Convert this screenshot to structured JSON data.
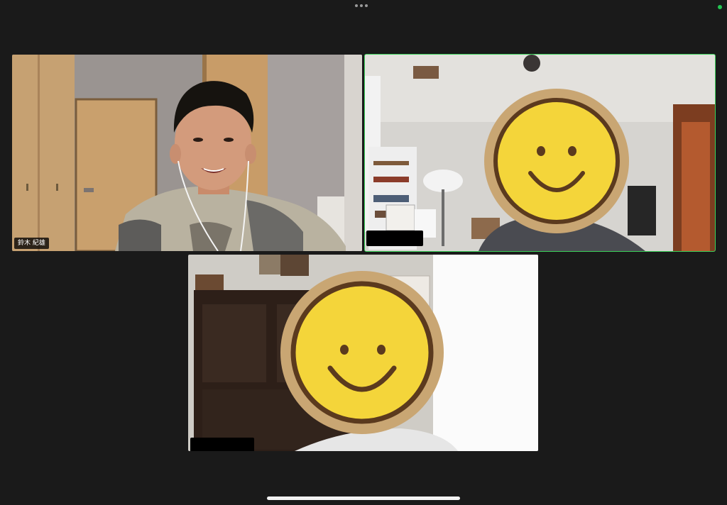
{
  "app": {
    "participants": [
      {
        "name": "鈴木 紀雄",
        "speaking": false,
        "face_obscured": false
      },
      {
        "name": "",
        "speaking": true,
        "face_obscured": true
      },
      {
        "name": "",
        "speaking": false,
        "face_obscured": true
      }
    ]
  },
  "icons": {
    "more": "more-horizontal-icon",
    "status": "connection-status-dot",
    "face_cover": "smiley-face-sticker"
  },
  "colors": {
    "background": "#1a1a1a",
    "active_speaker_border": "#3bd25a",
    "status_indicator": "#23c552",
    "smiley_face": "#f4d53a",
    "smiley_outline": "#5b3a1e",
    "smiley_wood_ring": "#c9a673"
  }
}
